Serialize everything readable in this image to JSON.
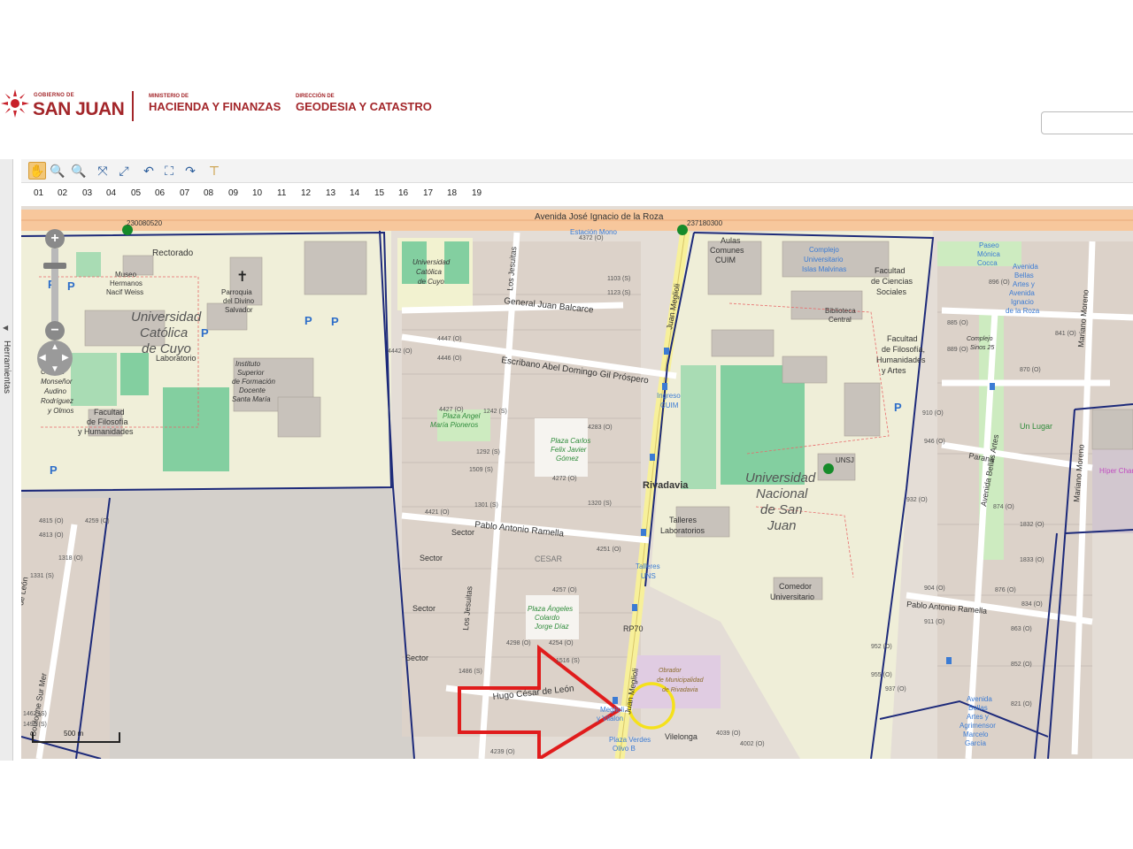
{
  "header": {
    "gobierno": "GOBIERNO DE",
    "province": "SAN JUAN",
    "ministry_small": "MINISTERIO DE",
    "ministry": "HACIENDA Y FINANZAS",
    "direction_small": "DIRECCIÓN DE",
    "direction": "GEODESIA Y CATASTRO"
  },
  "sidebar": {
    "label": "Herramientas",
    "arrow": "◀"
  },
  "toolbar": {
    "icons": [
      "hand-pan-icon",
      "zoom-in-icon",
      "zoom-out-icon",
      "zoom-extent-icon",
      "zoom-full-icon",
      "undo-icon",
      "zoom-box-icon",
      "redo-icon",
      "measure-icon"
    ]
  },
  "ruler": [
    "01",
    "02",
    "03",
    "04",
    "05",
    "06",
    "07",
    "08",
    "09",
    "10",
    "11",
    "12",
    "13",
    "14",
    "15",
    "16",
    "17",
    "18",
    "19"
  ],
  "map": {
    "nav": {
      "zoom_in": "+",
      "zoom_out": "−"
    },
    "scale": "500 m",
    "streets": {
      "avenida_roza": "Avenida José Ignacio de la Roza",
      "general_juan_balcarce": "General Juan Balcarce",
      "escribano": "Escribano Abel Domingo Gil Próspero",
      "pablo_antonio_ramella": "Pablo Antonio Ramella",
      "pablo_antonio_ramella_e": "Pablo Antonio Ramella",
      "hugo_cesar_de_leon": "Hugo César de León",
      "juan_meglioli_n": "Juan Meglioli",
      "juan_meglioli_s": "Juan Meglioli",
      "los_jesuitas_n": "Los Jesuitas",
      "los_jesuitas_s": "Los Jesuitas",
      "avenida_bellas_artes": "Avenida Bellas Artes",
      "mariano_moreno": "Mariano Moreno",
      "mariano_moreno_s": "Mariano Moreno",
      "vilelonga": "Vilelonga",
      "parana": "Paraná",
      "boulogne": "Boulogne Sur Mer",
      "leon": "de León",
      "rp70": "RP70"
    },
    "places": {
      "ucc_big": [
        "Universidad",
        "Católica",
        "de Cuyo"
      ],
      "unsj_big": [
        "Universidad",
        "Nacional",
        "de San",
        "Juan"
      ],
      "rivadavia": "Rivadavia",
      "rectorado": "Rectorado",
      "museo": [
        "Museo",
        "Hermanos",
        "Nacif Weiss"
      ],
      "parroquia": [
        "Parroquia",
        "del Divino",
        "Salvador"
      ],
      "laboratorio": "Laboratorio",
      "instituto": [
        "Instituto",
        "Superior",
        "de Formación",
        "Docente",
        "Santa María"
      ],
      "facultad_fh": [
        "Facultad",
        "de Filosofía",
        "y Humanidades"
      ],
      "colegio": [
        "Colegio",
        "Monseñor",
        "Audino",
        "Rodríguez",
        "y Olmos"
      ],
      "ucc_small": [
        "Universidad",
        "Católica",
        "de Cuyo"
      ],
      "aulas": [
        "Aulas",
        "Comunes",
        "CUIM"
      ],
      "complejo": [
        "Complejo",
        "Universitario",
        "Islas Malvinas"
      ],
      "fac_cs": [
        "Facultad",
        "de Ciencias",
        "Sociales"
      ],
      "biblioteca": [
        "Biblioteca",
        "Central"
      ],
      "fac_fil_e": [
        "Facultad",
        "de Filosofía,",
        "Humanidades",
        "y Artes"
      ],
      "ingreso": [
        "Ingreso",
        "CUIM"
      ],
      "talleres": [
        "Talleres",
        "Laboratorios"
      ],
      "talleres_uns": [
        "Talleres",
        "UNS"
      ],
      "comedor": [
        "Comedor",
        "Universitario"
      ],
      "unsj": "UNSJ",
      "plaza_pioneros": [
        "Plaza Angel",
        "María Pioneros"
      ],
      "plaza_carlos": [
        "Plaza Carlos",
        "Felix Javier",
        "Gómez"
      ],
      "plaza_angeles": [
        "Plaza Ángeles",
        "Colardo",
        "Jorge Díaz"
      ],
      "obrador": [
        "Obrador",
        "de Municipalidad",
        "de Rivadavia"
      ],
      "paseo": [
        "Paseo",
        "Mónica",
        "Cocca"
      ],
      "avenida_ba_label": [
        "Avenida",
        "Bellas",
        "Artes y",
        "Avenida",
        "Ignacio",
        "de la Roza"
      ],
      "complejo25": [
        "Complejo",
        "Sinos 25"
      ],
      "un_lugar": "Un Lugar",
      "hiper": "Híper Char",
      "cesar": "CESAR",
      "sector1": "Sector",
      "sector2": "Sector",
      "sector3": "Sector",
      "sector4": "Sector",
      "plaza_verdes": [
        "Plaza Verdes",
        "Olivo B"
      ],
      "meglioli_vilalon": [
        "Meglioli",
        "y Vilalon"
      ],
      "avenida_bottom": [
        "Avenida",
        "Bellas",
        "Artes y",
        "Agrimensor",
        "Marcelo",
        "García"
      ],
      "estacion": "Estación Mono",
      "road_num_1": "230080520",
      "road_num_2": "237180300",
      "house_nums": [
        "4372 (O)",
        "1103 (S)",
        "1123 (S)",
        "4447 (O)",
        "4446 (O)",
        "4442 (O)",
        "4427 (O)",
        "4421 (O)",
        "1242 (S)",
        "1292 (S)",
        "1301 (S)",
        "1509 (S)",
        "4283 (O)",
        "4272 (O)",
        "1320 (S)",
        "4251 (O)",
        "4257 (O)",
        "4254 (O)",
        "4298 (O)",
        "1516 (S)",
        "1486 (S)",
        "4039 (O)",
        "4002 (O)",
        "4259 (O)",
        "4239 (O)",
        "885 (O)",
        "896 (O)",
        "889 (O)",
        "841 (O)",
        "870 (O)",
        "910 (O)",
        "946 (O)",
        "932 (O)",
        "874 (O)",
        "1832 (O)",
        "1833 (O)",
        "904 (O)",
        "876 (O)",
        "834 (O)",
        "911 (O)",
        "863 (O)",
        "952 (O)",
        "955 (O)",
        "852 (O)",
        "937 (O)",
        "821 (O)",
        "4815 (O)",
        "4813 (O)",
        "1331 (S)",
        "1318 (O)",
        "1462 (S)",
        "1490 (S)"
      ]
    }
  }
}
